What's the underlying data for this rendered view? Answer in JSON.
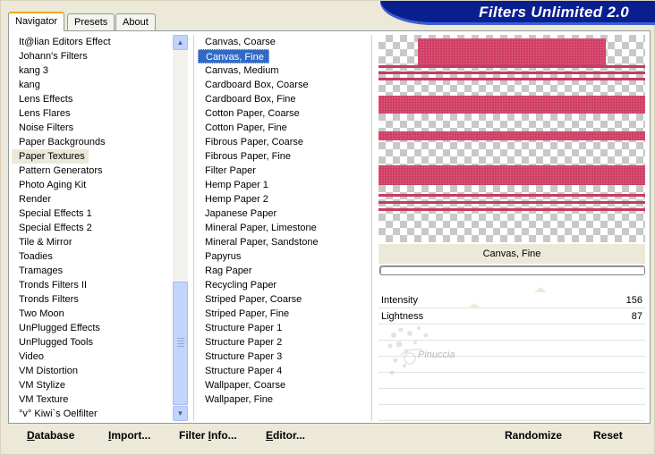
{
  "banner": {
    "title": "Filters Unlimited 2.0"
  },
  "tabs": [
    {
      "label": "Navigator",
      "active": true
    },
    {
      "label": "Presets",
      "active": false
    },
    {
      "label": "About",
      "active": false
    }
  ],
  "categories": {
    "items": [
      "It@lian Editors Effect",
      "Johann's Filters",
      "kang 3",
      "kang",
      "Lens Effects",
      "Lens Flares",
      "Noise Filters",
      "Paper Backgrounds",
      "Paper Textures",
      "Pattern Generators",
      "Photo Aging Kit",
      "Render",
      "Special Effects 1",
      "Special Effects 2",
      "Tile & Mirror",
      "Toadies",
      "Tramages",
      "Tronds Filters II",
      "Tronds Filters",
      "Two Moon",
      "UnPlugged Effects",
      "UnPlugged Tools",
      "Video",
      "VM Distortion",
      "VM Stylize",
      "VM Texture",
      "°v° Kiwi`s Oelfilter"
    ],
    "highlighted_index": 8
  },
  "filters": {
    "items": [
      "Canvas, Coarse",
      "Canvas, Fine",
      "Canvas, Medium",
      "Cardboard Box, Coarse",
      "Cardboard Box, Fine",
      "Cotton Paper, Coarse",
      "Cotton Paper, Fine",
      "Fibrous Paper, Coarse",
      "Fibrous Paper, Fine",
      "Filter Paper",
      "Hemp Paper 1",
      "Hemp Paper 2",
      "Japanese Paper",
      "Mineral Paper, Limestone",
      "Mineral Paper, Sandstone",
      "Papyrus",
      "Rag Paper",
      "Recycling Paper",
      "Striped Paper, Coarse",
      "Striped Paper, Fine",
      "Structure Paper 1",
      "Structure Paper 2",
      "Structure Paper 3",
      "Structure Paper 4",
      "Wallpaper, Coarse",
      "Wallpaper, Fine"
    ],
    "selected_index": 1
  },
  "preview": {
    "label": "Canvas, Fine",
    "progress": 0
  },
  "params": [
    {
      "label": "Intensity",
      "value": "156"
    },
    {
      "label": "Lightness",
      "value": "87"
    }
  ],
  "watermark": {
    "text": "Pinuccia"
  },
  "toolbar": {
    "database": {
      "u": "D",
      "rest": "atabase"
    },
    "import": {
      "u": "I",
      "rest": "mport..."
    },
    "filter_info": {
      "pre": "Filter ",
      "u": "I",
      "rest": "nfo..."
    },
    "editor": {
      "u": "E",
      "rest": "ditor..."
    },
    "randomize": "Randomize",
    "reset": "Reset"
  },
  "colors": {
    "selection": "#316ac5",
    "banner": "#0a1f8f",
    "preview_texture": "#d9426a"
  }
}
